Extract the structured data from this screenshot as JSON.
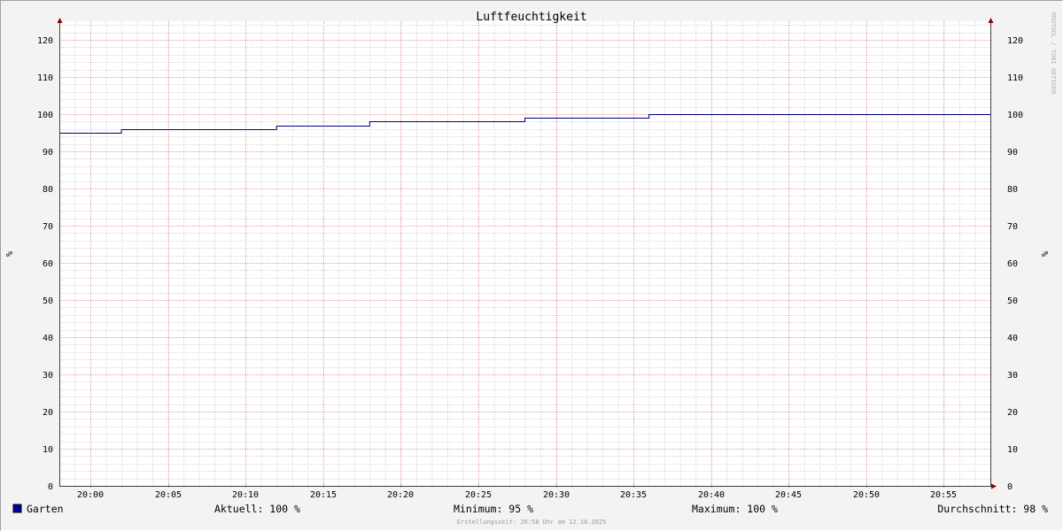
{
  "chart_data": {
    "type": "line",
    "title": "Luftfeuchtigkeit",
    "ylabel_left": "%",
    "ylabel_right": "%",
    "ylim": [
      0,
      125
    ],
    "yticks": [
      0,
      10,
      20,
      30,
      40,
      50,
      60,
      70,
      80,
      90,
      100,
      110,
      120
    ],
    "xlim": [
      "19:58",
      "20:58"
    ],
    "xticks": [
      "20:00",
      "20:05",
      "20:10",
      "20:15",
      "20:20",
      "20:25",
      "20:30",
      "20:35",
      "20:40",
      "20:45",
      "20:50",
      "20:55"
    ],
    "grid": true,
    "series": [
      {
        "name": "Garten",
        "color": "#000080",
        "x": [
          "19:58",
          "20:02",
          "20:12",
          "20:18",
          "20:28",
          "20:36",
          "20:58"
        ],
        "values": [
          95,
          96,
          97,
          98,
          99,
          100,
          100
        ],
        "step": true
      }
    ]
  },
  "legend": {
    "swatch_color": "#0000a0",
    "name": "Garten",
    "aktuell": "Aktuell: 100 %",
    "minimum": "Minimum:  95 %",
    "maximum": "Maximum: 100 %",
    "durchschnitt": "Durchschnitt:  98 %"
  },
  "footer": "Erstellungszeit: 20:58 Uhr am 12.10.2025",
  "watermark": "RRDTOOL / TOBI OETIKER"
}
